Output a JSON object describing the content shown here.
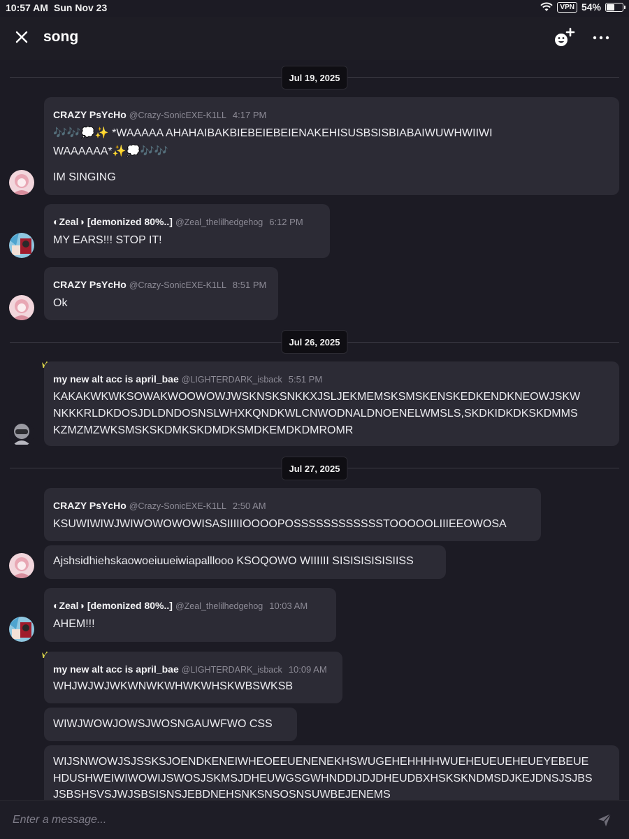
{
  "status_bar": {
    "time": "10:57 AM",
    "date": "Sun Nov 23",
    "vpn": "VPN",
    "battery_text": "54%",
    "battery_level": 0.54
  },
  "header": {
    "title": "song"
  },
  "dates": [
    "Jul 19, 2025",
    "Jul 26, 2025",
    "Jul 27, 2025"
  ],
  "messages": [
    {
      "name": "CRAZY PsYcHo",
      "handle": "@Crazy-SonicEXE-K1LL",
      "time": "4:17 PM",
      "line1": "🎶🎶💭✨ *WAAAAA AHAHAIBAKBIEBEIEBEIENAKEHISUSBSISBIABAIWUWHWIIWI",
      "line2": "WAAAAAA*✨💭🎶🎶",
      "line3": "IM SINGING"
    },
    {
      "name": "◐Zeal◑ [demonized 80%..]",
      "handle": "@Zeal_thelilhedgehog",
      "time": "6:12 PM",
      "text": "MY EARS!!! STOP IT!"
    },
    {
      "name": "CRAZY PsYcHo",
      "handle": "@Crazy-SonicEXE-K1LL",
      "time": "8:51 PM",
      "text": "Ok"
    },
    {
      "name": "my new alt acc is april_bae",
      "handle": "@LIGHTERDARK_isback",
      "time": "5:51 PM",
      "line1": "KAKAKWKWKSOWAKWOOWOWJWSKNSKSNKKXJSLJEKMEMSKSMSKENSKEDKENDKNEOWJSKW",
      "line2": "NKKKRLDKDOSJDLDNDOSNSLWHXKQNDKWLCNWODNALDNOENELWMSLS,SKDKIDKDKSKDMMS",
      "line3": "KZMZMZWKSMSKSKDMKSKDMDKSMDKEMDKDMROMR"
    },
    {
      "name": "CRAZY PsYcHo",
      "handle": "@Crazy-SonicEXE-K1LL",
      "time": "2:50 AM",
      "text": "KSUWIWIWJWIWOWOWOWISASIIIIIOOOOPOSSSSSSSSSSSSTOOOOOLIIIEEOWOSA"
    },
    {
      "text": "Ajshsidhiehskaowoeiuueiwiapalllooo KSOQOWO WIIIIII SISISISISISIISS"
    },
    {
      "name": "◐Zeal◑ [demonized 80%..]",
      "handle": "@Zeal_thelilhedgehog",
      "time": "10:03 AM",
      "text": "AHEM!!!"
    },
    {
      "name": "my new alt acc is april_bae",
      "handle": "@LIGHTERDARK_isback",
      "time": "10:09 AM",
      "text": "WHJWJWJWKWNWKWHWKWHSKWBSWKSB"
    },
    {
      "text": "WIWJWOWJOWSJWOSNGAUWFWO CSS"
    },
    {
      "line1": "WIJSNWOWJSJSSKSJOENDKENEIWHEOEEUENENEKHSWUGEHEHHHHWUEHEUEUEHEUEYEBEUE",
      "line2": "HDUSHWEIWIWOWIJSWOSJSKMSJDHEUWGSGWHNDDIJDJDHEUDBXHSKSKNDMSDJKEJDNSJSJBS",
      "line3": "JSBSHSVSJWJSBSISNSJEBDNEHSNKSNSOSNSUWBEJENEMS"
    }
  ],
  "input": {
    "placeholder": "Enter a message..."
  },
  "colors": {
    "background": "#1c1b24",
    "bubble": "#2c2b35",
    "date_pill": "#0f0e13",
    "crown": "#d8d24a"
  }
}
